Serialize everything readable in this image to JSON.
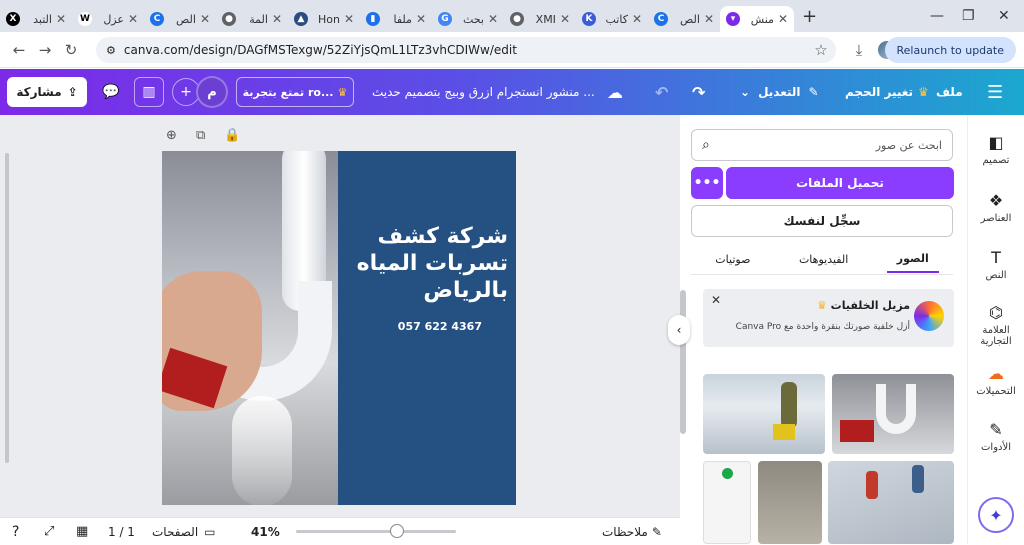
{
  "browser": {
    "tabs": [
      {
        "title": "التبد",
        "icon": "x-logo-icon",
        "color": "#000000",
        "glyph": "X"
      },
      {
        "title": "عزل",
        "icon": "wikipedia-icon",
        "color": "#ffffff",
        "glyph": "W"
      },
      {
        "title": "الص",
        "icon": "circle-logo-icon",
        "color": "#1a73e8",
        "glyph": "C"
      },
      {
        "title": "المة",
        "icon": "globe-icon",
        "color": "#5f6368",
        "glyph": "●"
      },
      {
        "title": "Hon",
        "icon": "triangle-logo-icon",
        "color": "#2b4c7e",
        "glyph": "▲"
      },
      {
        "title": "ملفا",
        "icon": "chart-logo-icon",
        "color": "#1f6feb",
        "glyph": "▮"
      },
      {
        "title": "بحث",
        "icon": "google-icon",
        "color": "#4285f4",
        "glyph": "G"
      },
      {
        "title": "XMI",
        "icon": "globe-icon",
        "color": "#5f6368",
        "glyph": "●"
      },
      {
        "title": "كاتب",
        "icon": "k-logo-icon",
        "color": "#3b5bdb",
        "glyph": "K"
      },
      {
        "title": "الص",
        "icon": "circle-logo-icon",
        "color": "#1a73e8",
        "glyph": "C"
      },
      {
        "title": "منش",
        "icon": "canva-icon",
        "color": "#7d2ae8",
        "glyph": "▾",
        "active": true
      }
    ],
    "url": "canva.com/design/DAGfMSTexgw/52ZiYjsQmL1LTz3vhCDIWw/edit",
    "relaunch_label": "Relaunch to update"
  },
  "topbar": {
    "file": "ملف",
    "resize": "تغيير الحجم",
    "edit": "التعديل",
    "doc_title": "منشور انستجرام ازرق وبيج بتصميم حديث ...",
    "try_pro": "تمتع بتجربة ro...",
    "avatar_letter": "م",
    "share": "مشاركة"
  },
  "design": {
    "title_lines": [
      "شركة كشف",
      "تسربات المياه",
      "بالرياض"
    ],
    "phone": "057 622 4367"
  },
  "bottombar": {
    "notes": "ملاحظات",
    "zoom": "41%",
    "pages": "الصفحات",
    "page_count": "1 / 1"
  },
  "panel": {
    "search_placeholder": "ابحث عن صور",
    "upload_label": "تحميل الملفات",
    "more_label": "•••",
    "record_label": "سجِّل لنفسك",
    "tabs": [
      "الصور",
      "الفيديوهات",
      "صوتيات"
    ],
    "promo_title": "مزيل الخلفيات",
    "promo_text": "أزل خلفية صورتك بنقرة واحدة مع Canva Pro"
  },
  "sidebar": {
    "items": [
      {
        "label": "تصميم",
        "icon": "design-icon",
        "glyph": "◧"
      },
      {
        "label": "العناصر",
        "icon": "elements-icon",
        "glyph": "❖"
      },
      {
        "label": "النص",
        "icon": "text-icon",
        "glyph": "T"
      },
      {
        "label": "العلامة التجارية",
        "icon": "brand-icon",
        "glyph": "⌬"
      },
      {
        "label": "التحميلات",
        "icon": "uploads-icon",
        "glyph": "☁"
      },
      {
        "label": "الأدوات",
        "icon": "tools-icon",
        "glyph": "✎"
      }
    ]
  }
}
